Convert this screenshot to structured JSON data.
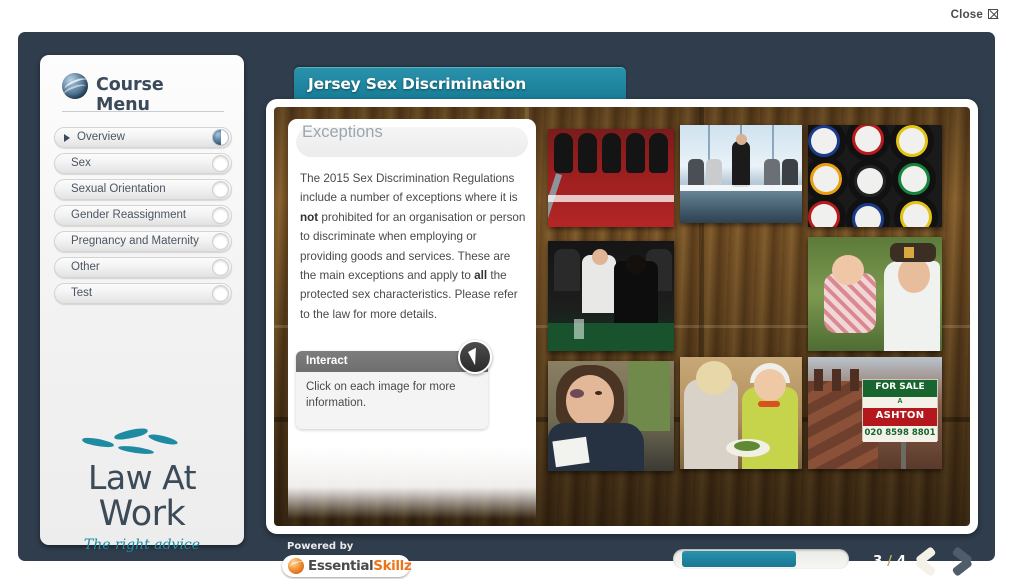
{
  "window": {
    "close_label": "Close",
    "close_icon": "close-box-icon"
  },
  "sidebar": {
    "title": "Course Menu",
    "logo_icon": "blue-sphere-icon",
    "items": [
      {
        "label": "Overview",
        "state": "current"
      },
      {
        "label": "Sex",
        "state": "not-started"
      },
      {
        "label": "Sexual Orientation",
        "state": "not-started"
      },
      {
        "label": "Gender Reassignment",
        "state": "not-started"
      },
      {
        "label": "Pregnancy and Maternity",
        "state": "not-started"
      },
      {
        "label": "Other",
        "state": "not-started"
      },
      {
        "label": "Test",
        "state": "not-started"
      }
    ],
    "brand": {
      "line1": "Law At",
      "line2": "Work",
      "tagline": "The right advice",
      "mark_icon": "fish-wave-icon",
      "accent_color": "#1f8ba3"
    }
  },
  "course": {
    "tab_title": "Jersey Sex Discrimination",
    "tab_color": "#1f87a1"
  },
  "slide": {
    "heading": "Exceptions",
    "body_part1": "The 2015 Sex Discrimination Regulations include a number of exceptions where it is ",
    "body_bold1": "not",
    "body_part2": " prohibited for an organisation or person to discriminate when employing or providing goods and services. These are the main exceptions and apply to ",
    "body_bold2": "all",
    "body_part3": " the protected sex characteristics. Please refer to the law for more details.",
    "interact": {
      "title": "Interact",
      "text": "Click on each image for more information.",
      "icon": "cursor-pointer-icon"
    },
    "images": [
      {
        "name": "guards-image",
        "alt": "Royal guards in red uniforms and bearskin hats"
      },
      {
        "name": "boardroom-image",
        "alt": "Businesswoman walking along a boardroom table"
      },
      {
        "name": "charity-tins-image",
        "alt": "Coloured charity collection tins"
      },
      {
        "name": "gambling-image",
        "alt": "Men in black tie at a gaming table"
      },
      {
        "name": "nanny-baby-image",
        "alt": "Nurse in uniform holding a baby"
      },
      {
        "name": "abuse-refuge-image",
        "alt": "Woman with a bruised eye"
      },
      {
        "name": "carer-elderly-image",
        "alt": "Carer serving food to an elderly woman"
      },
      {
        "name": "for-sale-image",
        "alt": "Estate agent For Sale sign on terraced houses"
      }
    ],
    "for_sale_sign": {
      "line1": "FOR SALE",
      "line2": "A",
      "line3": "ASHTON",
      "phone": "020 8598 8801"
    }
  },
  "footer": {
    "powered_by": "Powered by",
    "vendor_part1": "Essential",
    "vendor_part2": "Skillz",
    "vendor_icon": "orange-sphere-icon",
    "progress_percent": 72,
    "page_current": "3",
    "page_separator": "/",
    "page_total": "4",
    "prev_icon": "chevron-left-icon",
    "next_icon": "chevron-right-icon"
  }
}
